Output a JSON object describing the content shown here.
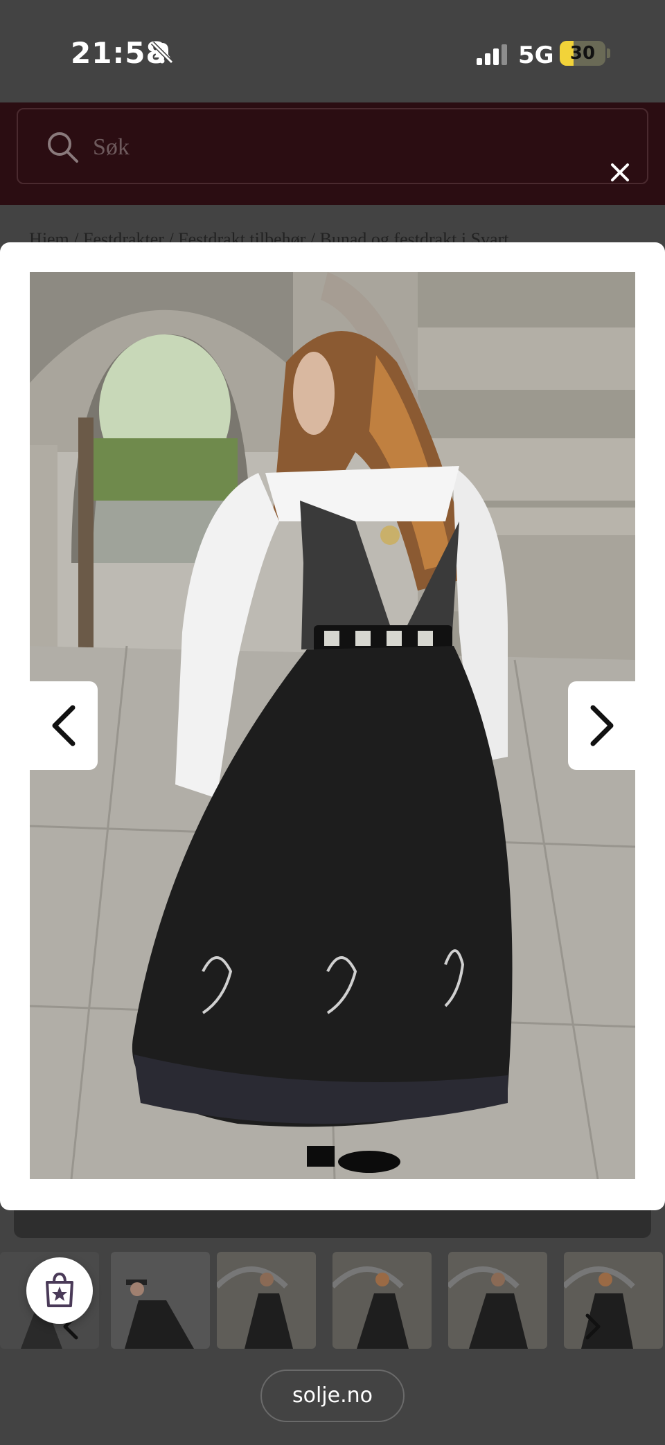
{
  "status_bar": {
    "time": "21:58",
    "network": "5G",
    "battery_level": "30",
    "battery_fraction": 0.3,
    "icons": [
      "bell-slash-icon",
      "signal-icon"
    ]
  },
  "search": {
    "placeholder": "Søk",
    "icon": "search-icon",
    "close_icon": "close-icon"
  },
  "breadcrumb": "Hjem / Festdrakter / Festdrakt tilbehør / Bunad og festdrakt i Svart",
  "lightbox": {
    "prev_icon": "chevron-left-icon",
    "next_icon": "chevron-right-icon"
  },
  "thumbnails": {
    "count": 6,
    "shop_icon": "shopping-bag-star-icon"
  },
  "browser": {
    "url": "solje.no"
  },
  "colors": {
    "header_bg": "#2b0d12",
    "page_bg": "#434343",
    "battery": "#f2d339"
  }
}
